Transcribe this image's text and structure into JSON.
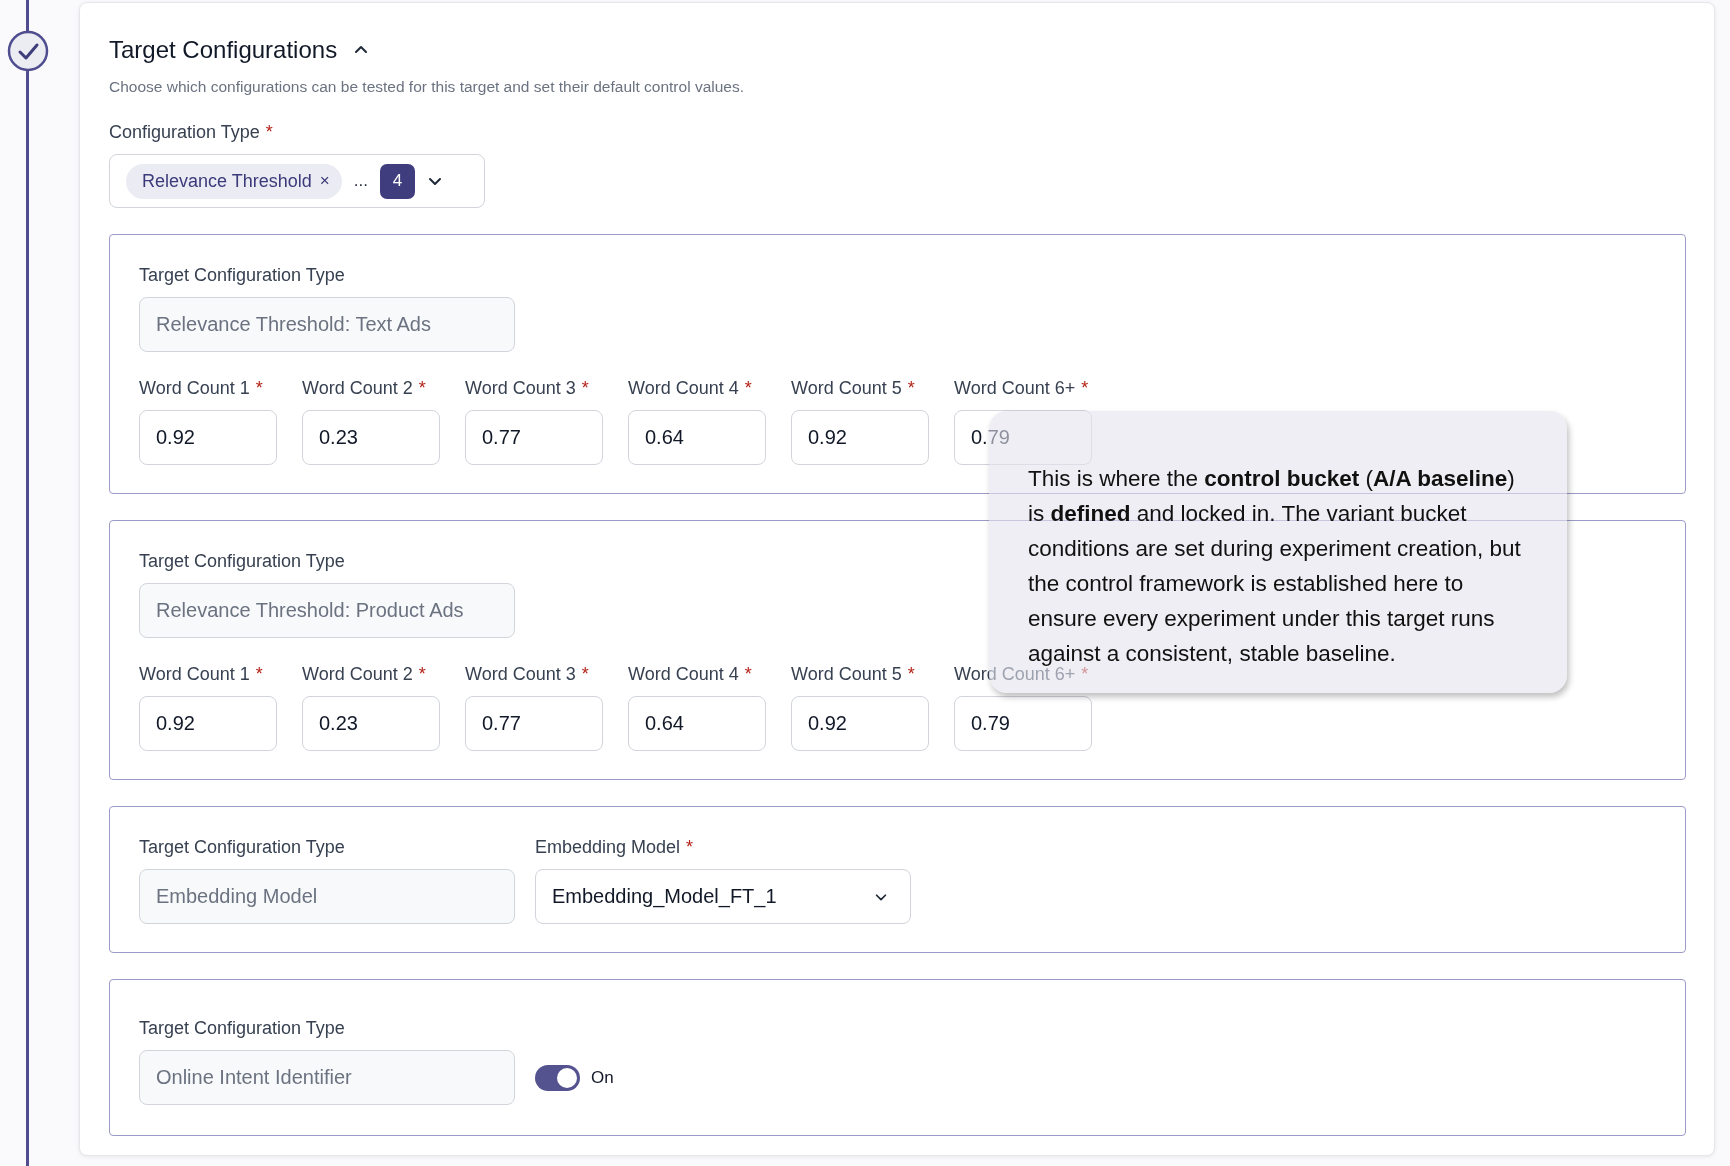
{
  "step": {
    "completed": true
  },
  "section": {
    "title": "Target Configurations",
    "expanded": true,
    "description": "Choose which configurations can be tested for this target and set their default control values."
  },
  "configuration_type": {
    "label": "Configuration Type",
    "required_mark": "*",
    "chips": [
      {
        "label": "Relevance Threshold",
        "remove": "×"
      }
    ],
    "overflow": "...",
    "count": "4"
  },
  "configs": [
    {
      "kind": "thresholds",
      "type_label": "Target Configuration Type",
      "type_value": "Relevance Threshold: Text Ads",
      "type_disabled": true,
      "fields": [
        {
          "label": "Word Count 1",
          "required_mark": "*",
          "value": "0.92"
        },
        {
          "label": "Word Count 2",
          "required_mark": "*",
          "value": "0.23"
        },
        {
          "label": "Word Count 3",
          "required_mark": "*",
          "value": "0.77"
        },
        {
          "label": "Word Count 4",
          "required_mark": "*",
          "value": "0.64"
        },
        {
          "label": "Word Count 5",
          "required_mark": "*",
          "value": "0.92"
        },
        {
          "label": "Word Count 6+",
          "required_mark": "*",
          "value": "0.79"
        }
      ]
    },
    {
      "kind": "thresholds",
      "type_label": "Target Configuration Type",
      "type_value": "Relevance Threshold: Product Ads",
      "type_disabled": true,
      "fields": [
        {
          "label": "Word Count 1",
          "required_mark": "*",
          "value": "0.92"
        },
        {
          "label": "Word Count 2",
          "required_mark": "*",
          "value": "0.23"
        },
        {
          "label": "Word Count 3",
          "required_mark": "*",
          "value": "0.77"
        },
        {
          "label": "Word Count 4",
          "required_mark": "*",
          "value": "0.64"
        },
        {
          "label": "Word Count 5",
          "required_mark": "*",
          "value": "0.92"
        },
        {
          "label": "Word Count 6+",
          "required_mark": "*",
          "value": "0.79"
        }
      ]
    },
    {
      "kind": "select",
      "type_label": "Target Configuration Type",
      "type_value": "Embedding Model",
      "type_disabled": true,
      "select_label": "Embedding Model",
      "required_mark": "*",
      "select_value": "Embedding_Model_FT_1"
    },
    {
      "kind": "toggle",
      "type_label": "Target Configuration Type",
      "type_value": "Online Intent Identifier",
      "type_disabled": true,
      "on": true,
      "toggle_label": "On"
    }
  ],
  "tooltip": {
    "text": "This is where the **control bucket** (**A/A baseline**) is **defined** and locked in. The variant bucket conditions are set during experiment creation, but the control framework is established here to ensure every experiment under this target runs against a consistent, stable baseline."
  }
}
